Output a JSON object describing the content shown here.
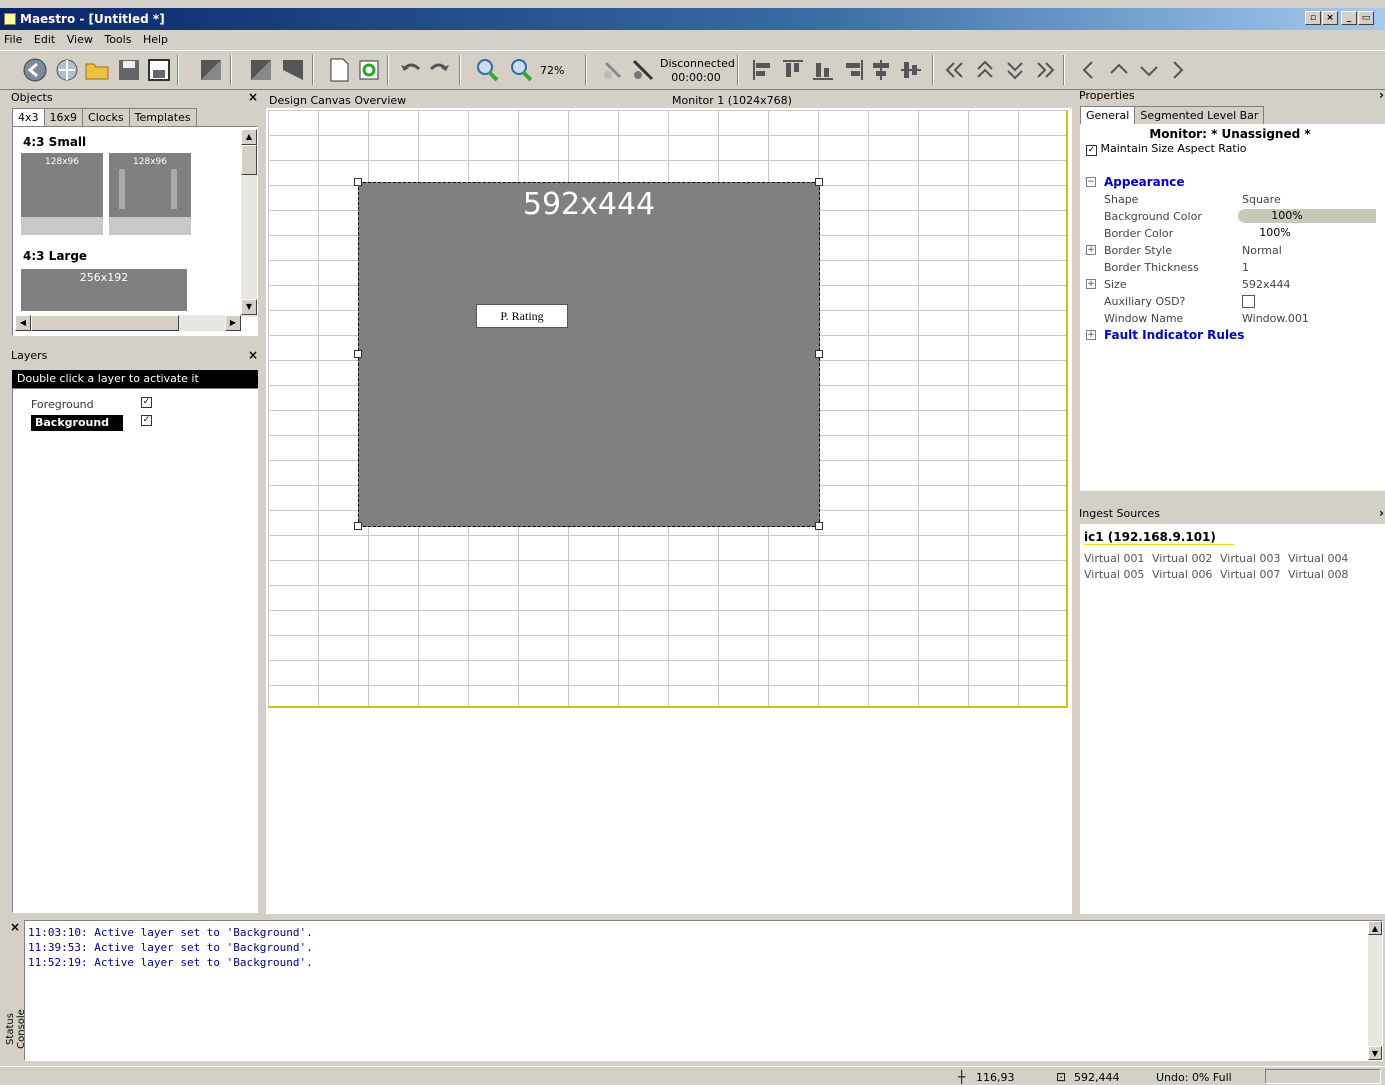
{
  "window": {
    "title": "Maestro - [Untitled *]"
  },
  "menu": [
    "File",
    "Edit",
    "View",
    "Tools",
    "Help"
  ],
  "toolbar": {
    "zoom": "72%",
    "conn_status": "Disconnected",
    "conn_time": "00:00:00"
  },
  "objects": {
    "title": "Objects",
    "tabs": [
      "4x3",
      "16x9",
      "Clocks",
      "Templates"
    ],
    "section1": "4:3 Small",
    "thumb_small": "128x96",
    "section2": "4:3 Large",
    "thumb_large": "256x192"
  },
  "layers": {
    "title": "Layers",
    "hint": "Double click a layer to activate it",
    "items": [
      {
        "name": "Foreground",
        "checked": true
      },
      {
        "name": "Background",
        "checked": true,
        "active": true
      }
    ]
  },
  "canvas": {
    "title": "Design Canvas Overview",
    "monitor": "Monitor 1 (1024x768)",
    "window_label": "592x444",
    "rating_label": "P. Rating"
  },
  "properties": {
    "title": "Properties",
    "tabs": [
      "General",
      "Segmented Level Bar"
    ],
    "monitor_line": "Monitor: * Unassigned *",
    "aspect_label": "Maintain Size Aspect Ratio",
    "section_appearance": "Appearance",
    "rows": [
      {
        "k": "Shape",
        "v": "Square"
      },
      {
        "k": "Background Color",
        "v": "100%"
      },
      {
        "k": "Border Color",
        "v": "100%"
      },
      {
        "k": "Border Style",
        "v": "Normal"
      },
      {
        "k": "Border Thickness",
        "v": "1"
      },
      {
        "k": "Size",
        "v": "592x444"
      },
      {
        "k": "Auxiliary OSD?",
        "v": ""
      },
      {
        "k": "Window Name",
        "v": "Window.001"
      }
    ],
    "section_fault": "Fault Indicator Rules"
  },
  "ingest": {
    "title": "Ingest Sources",
    "server": "ic1 (192.168.9.101)",
    "sources": [
      "Virtual 001",
      "Virtual 002",
      "Virtual 003",
      "Virtual 004",
      "Virtual 005",
      "Virtual 006",
      "Virtual 007",
      "Virtual 008"
    ]
  },
  "console": {
    "label": "Status Console",
    "lines": [
      "11:03:10: Active layer set to 'Background'.",
      "11:39:53: Active layer set to 'Background'.",
      "11:52:19: Active layer set to 'Background'."
    ]
  },
  "statusbar": {
    "position": "116,93",
    "size": "592,444",
    "undo": "Undo: 0% Full"
  },
  "colors": {
    "accent": "#0000cc",
    "canvas_window": "#808080",
    "title_start": "#0a246a"
  }
}
